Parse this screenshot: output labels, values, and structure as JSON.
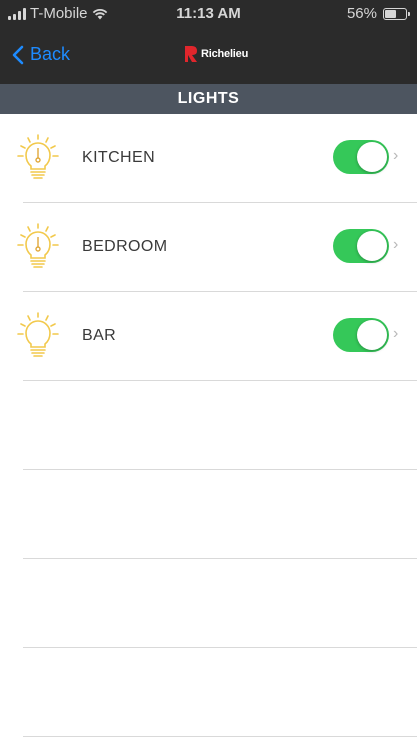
{
  "status_bar": {
    "carrier": "T-Mobile",
    "time": "11:13 AM",
    "battery": "56%",
    "battery_level": 0.56
  },
  "nav": {
    "back_label": "Back",
    "logo_text": "Richelieu",
    "accent_color": "#1e8bff",
    "logo_color": "#e0262c"
  },
  "section": {
    "title": "LIGHTS"
  },
  "lights": [
    {
      "label": "KITCHEN",
      "on": true
    },
    {
      "label": "BEDROOM",
      "on": true
    },
    {
      "label": "BAR",
      "on": true
    }
  ],
  "toggle_color": "#35c859"
}
